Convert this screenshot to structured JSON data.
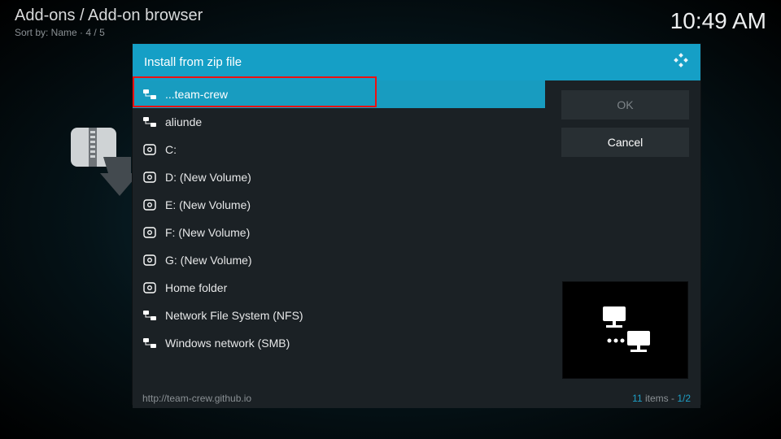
{
  "header": {
    "breadcrumb": "Add-ons / Add-on browser",
    "sort_label": "Sort by: Name",
    "position": "4 / 5",
    "clock": "10:49 AM"
  },
  "dialog": {
    "title": "Install from zip file",
    "ok": "OK",
    "cancel": "Cancel",
    "path": "http://team-crew.github.io",
    "items_count": "11",
    "items_suffix": " items - ",
    "page": "1/2",
    "list": [
      {
        "label": "...team-crew",
        "icon": "net",
        "selected": true
      },
      {
        "label": "aliunde",
        "icon": "net"
      },
      {
        "label": "C:",
        "icon": "disk"
      },
      {
        "label": "D: (New Volume)",
        "icon": "disk"
      },
      {
        "label": "E: (New Volume)",
        "icon": "disk"
      },
      {
        "label": "F: (New Volume)",
        "icon": "disk"
      },
      {
        "label": "G: (New Volume)",
        "icon": "disk"
      },
      {
        "label": "Home folder",
        "icon": "disk"
      },
      {
        "label": "Network File System (NFS)",
        "icon": "net"
      },
      {
        "label": "Windows network (SMB)",
        "icon": "net"
      }
    ]
  }
}
